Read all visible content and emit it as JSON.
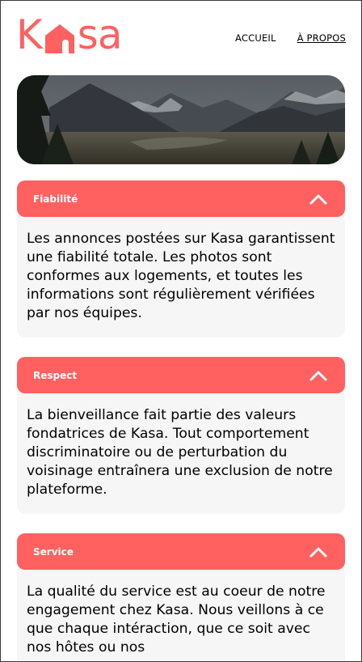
{
  "logo": {
    "letters_left": "K",
    "letters_right": "sa",
    "house_icon": "house-icon"
  },
  "nav": {
    "home_label": "ACCUEIL",
    "about_label": "À PROPOS"
  },
  "banner": {
    "image": "mountain-landscape"
  },
  "sections": [
    {
      "title": "Fiabilité",
      "text": "Les annonces postées sur Kasa garantissent une fiabilité totale. Les photos sont conformes aux logements, et toutes les informations sont régulièrement vérifiées par nos équipes."
    },
    {
      "title": "Respect",
      "text": "La bienveillance fait partie des valeurs fondatrices de Kasa. Tout comportement discriminatoire ou de perturbation du voisinage entraînera une exclusion de notre plateforme."
    },
    {
      "title": "Service",
      "text": "La qualité du service est au coeur de notre engagement chez Kasa. Nous veillons à ce que chaque intéraction, que ce soit avec nos hôtes ou nos"
    }
  ],
  "colors": {
    "brand": "#ff6060",
    "panel": "#f6f6f6"
  }
}
